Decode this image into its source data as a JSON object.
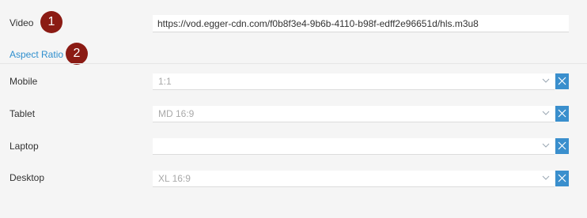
{
  "video": {
    "label": "Video",
    "value": "https://vod.egger-cdn.com/f0b8f3e4-9b6b-4110-b98f-edff2e96651d/hls.m3u8",
    "badge": "1"
  },
  "aspect_ratio": {
    "link_label": "Aspect Ratio",
    "badge": "2",
    "rows": [
      {
        "label": "Mobile",
        "value": "1:1"
      },
      {
        "label": "Tablet",
        "value": "MD 16:9"
      },
      {
        "label": "Laptop",
        "value": ""
      },
      {
        "label": "Desktop",
        "value": "XL 16:9"
      }
    ]
  },
  "colors": {
    "badge": "#8b1b14",
    "link": "#2f8fce",
    "clear_button": "#3a8fcd",
    "background": "#f5f5f5"
  },
  "icons": {
    "select_chevron": "chevron-down-icon",
    "clear": "close-icon"
  }
}
